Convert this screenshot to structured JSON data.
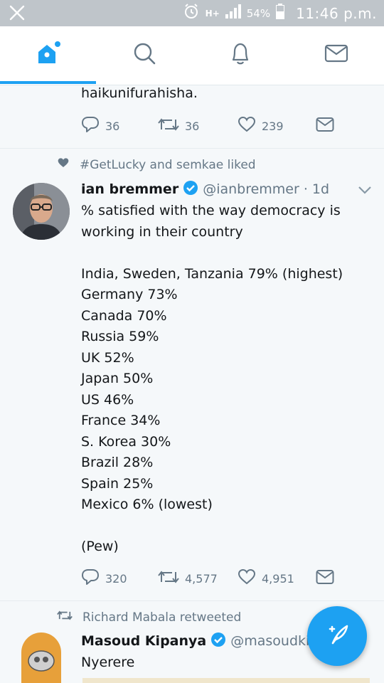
{
  "status_bar": {
    "network": "H+",
    "battery_pct": "54%",
    "time": "11:46 p.m."
  },
  "nav": {
    "tabs": [
      {
        "icon": "home-icon",
        "active": true
      },
      {
        "icon": "search-icon",
        "active": false
      },
      {
        "icon": "notifications-icon",
        "active": false
      },
      {
        "icon": "messages-icon",
        "active": false
      }
    ],
    "accent": "#1da1f2"
  },
  "tweet_prev": {
    "text_tail": "haikunifurahisha.",
    "replies": "36",
    "retweets": "36",
    "likes": "239"
  },
  "tweet_main": {
    "social_context": "#GetLucky and semkae liked",
    "name": "ian bremmer",
    "handle": "@ianbremmer",
    "time": "1d",
    "text": "% satisfied with the way democracy is\nworking in their country\n\nIndia, Sweden, Tanzania 79% (highest)\nGermany 73%\nCanada 70%\nRussia 59%\nUK 52%\nJapan 50%\nUS 46%\nFrance 34%\nS. Korea 30%\nBrazil 28%\nSpain 25%\nMexico 6% (lowest)\n\n(Pew)",
    "replies": "320",
    "retweets": "4,577",
    "likes": "4,951"
  },
  "tweet_next": {
    "social_context": "Richard Mabala retweeted",
    "name": "Masoud Kipanya",
    "handle": "@masoudkip...",
    "text": "Nyerere"
  }
}
